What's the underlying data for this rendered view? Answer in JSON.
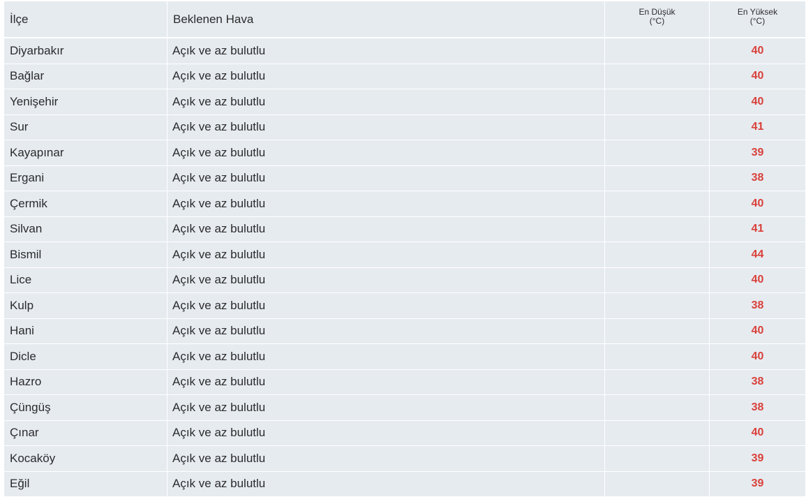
{
  "headers": {
    "district": "İlçe",
    "weather": "Beklenen Hava",
    "min_line1": "En Düşük",
    "min_line2": "(°C)",
    "max_line1": "En Yüksek",
    "max_line2": "(°C)"
  },
  "colors": {
    "row_bg": "#e6ebf0",
    "max_temp": "#d9413a",
    "text": "#2b2b2b"
  },
  "rows": [
    {
      "district": "Diyarbakır",
      "weather": "Açık ve az bulutlu",
      "min": "",
      "max": "40"
    },
    {
      "district": "Bağlar",
      "weather": "Açık ve az bulutlu",
      "min": "",
      "max": "40"
    },
    {
      "district": "Yenişehir",
      "weather": "Açık ve az bulutlu",
      "min": "",
      "max": "40"
    },
    {
      "district": "Sur",
      "weather": "Açık ve az bulutlu",
      "min": "",
      "max": "41"
    },
    {
      "district": "Kayapınar",
      "weather": "Açık ve az bulutlu",
      "min": "",
      "max": "39"
    },
    {
      "district": "Ergani",
      "weather": "Açık ve az bulutlu",
      "min": "",
      "max": "38"
    },
    {
      "district": "Çermik",
      "weather": "Açık ve az bulutlu",
      "min": "",
      "max": "40"
    },
    {
      "district": "Silvan",
      "weather": "Açık ve az bulutlu",
      "min": "",
      "max": "41"
    },
    {
      "district": "Bismil",
      "weather": "Açık ve az bulutlu",
      "min": "",
      "max": "44"
    },
    {
      "district": "Lice",
      "weather": "Açık ve az bulutlu",
      "min": "",
      "max": "40"
    },
    {
      "district": "Kulp",
      "weather": "Açık ve az bulutlu",
      "min": "",
      "max": "38"
    },
    {
      "district": "Hani",
      "weather": "Açık ve az bulutlu",
      "min": "",
      "max": "40"
    },
    {
      "district": "Dicle",
      "weather": "Açık ve az bulutlu",
      "min": "",
      "max": "40"
    },
    {
      "district": "Hazro",
      "weather": "Açık ve az bulutlu",
      "min": "",
      "max": "38"
    },
    {
      "district": "Çüngüş",
      "weather": "Açık ve az bulutlu",
      "min": "",
      "max": "38"
    },
    {
      "district": "Çınar",
      "weather": "Açık ve az bulutlu",
      "min": "",
      "max": "40"
    },
    {
      "district": "Kocaköy",
      "weather": "Açık ve az bulutlu",
      "min": "",
      "max": "39"
    },
    {
      "district": "Eğil",
      "weather": "Açık ve az bulutlu",
      "min": "",
      "max": "39"
    }
  ]
}
